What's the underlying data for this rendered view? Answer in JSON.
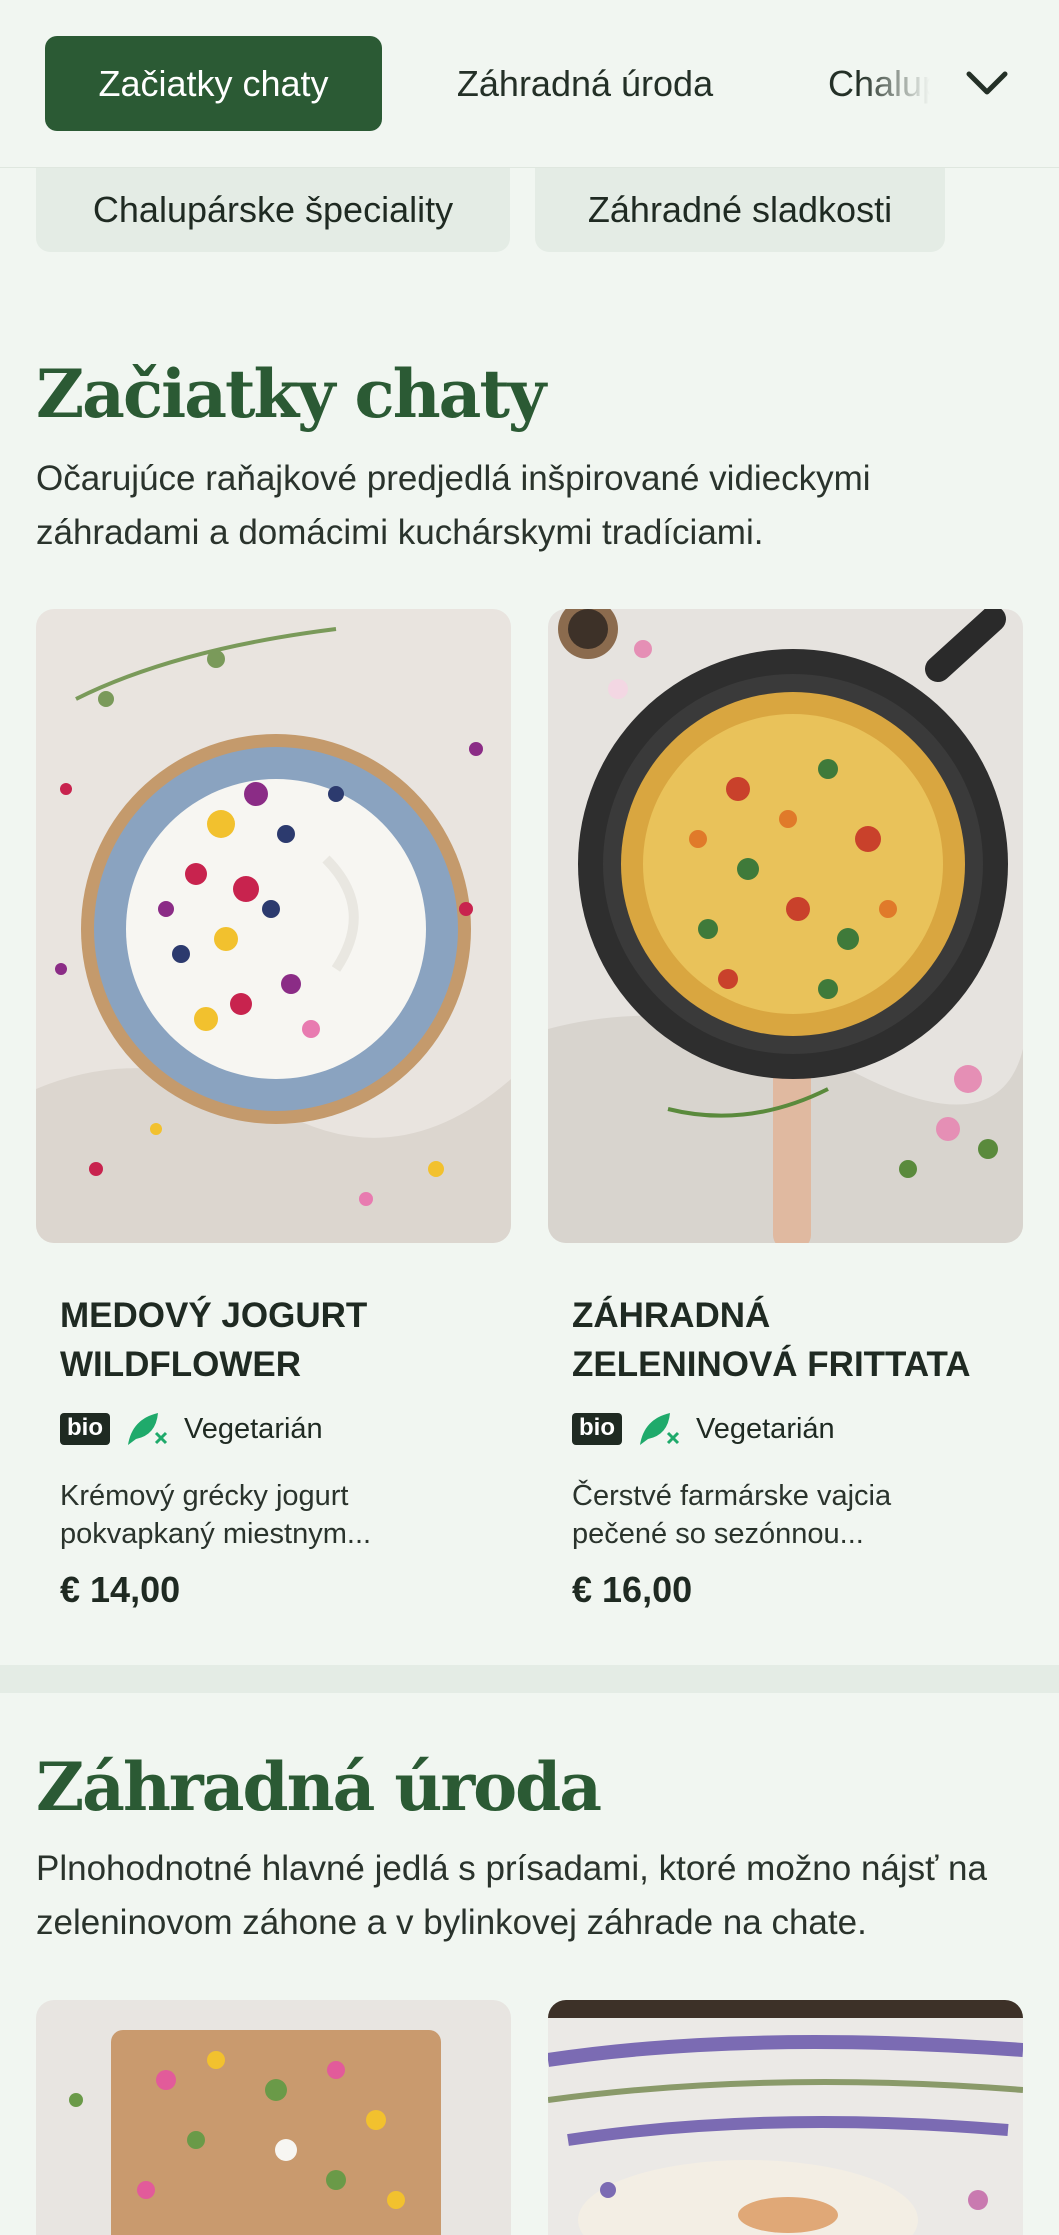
{
  "nav": {
    "tabs": [
      {
        "label": "Začiatky chaty",
        "active": true
      },
      {
        "label": "Záhradná úroda",
        "active": false
      },
      {
        "label": "Chalupárske špeciality",
        "active": false
      }
    ],
    "more_icon": "chevron-down-icon",
    "chips": [
      "Chalupárske špeciality",
      "Záhradné sladkosti"
    ]
  },
  "sections": [
    {
      "title": "Začiatky chaty",
      "description": "Očarujúce raňajkové predjedlá inšpirované vidieckymi záhradami a domácimi kuchárskymi tradíciami.",
      "items": [
        {
          "name": "MEDOVÝ JOGURT WILDFLOWER",
          "badge": "bio",
          "diet_icon": "leaf-vegetarian-icon",
          "diet": "Vegetarián",
          "description": "Krémový grécky jogurt pokvapkaný miestnym...",
          "price": "€ 14,00"
        },
        {
          "name": "ZÁHRADNÁ ZELENINOVÁ FRITTATA",
          "badge": "bio",
          "diet_icon": "leaf-vegetarian-icon",
          "diet": "Vegetarián",
          "description": "Čerstvé farmárske vajcia pečené so sezónnou...",
          "price": "€ 16,00"
        }
      ]
    },
    {
      "title": "Záhradná úroda",
      "description": "Plnohodnotné hlavné jedlá s prísadami, ktoré možno nájsť na zeleninovom záhone a v bylinkovej záhrade na chate."
    }
  ],
  "colors": {
    "accent": "#2b5a34",
    "background": "#f1f6f1",
    "chip": "#e4ece5",
    "diet_icon": "#1faa6b"
  }
}
